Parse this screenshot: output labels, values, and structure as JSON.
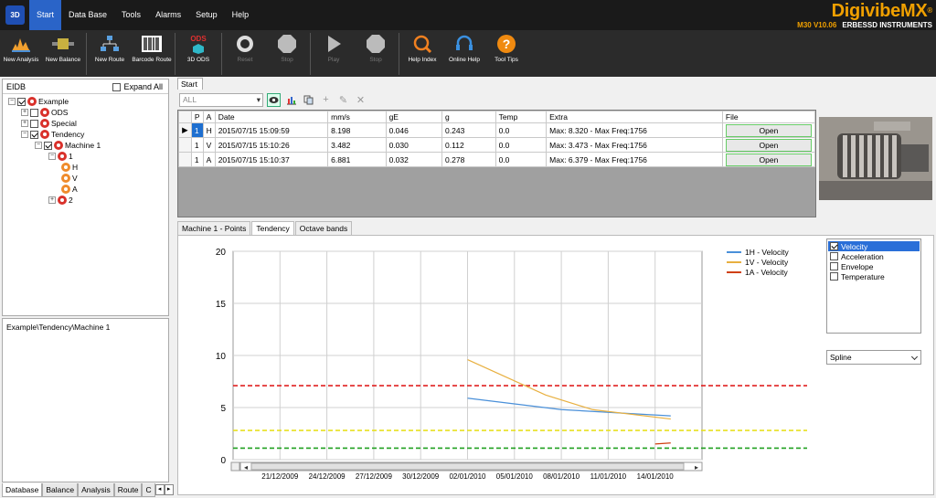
{
  "menu": {
    "logo": "3D",
    "items": [
      "Start",
      "Data Base",
      "Tools",
      "Alarms",
      "Setup",
      "Help"
    ],
    "active": "Start"
  },
  "brand": {
    "name": "DigivibeMX",
    "trademark": "®",
    "version": "M30 V10.06",
    "company": "ERBESSD INSTRUMENTS"
  },
  "ribbon": {
    "buttons": [
      {
        "label": "New Analysis",
        "icon": "spectrum-icon"
      },
      {
        "label": "New Balance",
        "icon": "rotor-icon"
      },
      {
        "label": "New Route",
        "icon": "org-chart-icon"
      },
      {
        "label": "Barcode Route",
        "icon": "barcode-icon"
      },
      {
        "label": "3D ODS",
        "icon": "ods-cube-icon",
        "badge": "ODS"
      },
      {
        "label": "Reset",
        "icon": "reset-icon"
      },
      {
        "label": "Stop",
        "icon": "stop-icon"
      },
      {
        "label": "Play",
        "icon": "play-icon"
      },
      {
        "label": "Stop",
        "icon": "stop-icon"
      },
      {
        "label": "Help Index",
        "icon": "help-index-icon"
      },
      {
        "label": "Online Help",
        "icon": "headset-icon"
      },
      {
        "label": "Tool Tips",
        "icon": "question-icon"
      }
    ]
  },
  "eidb": {
    "title": "EIDB",
    "expand_all": "Expand All",
    "tree": [
      {
        "label": "Example"
      },
      {
        "label": "ODS"
      },
      {
        "label": "Special"
      },
      {
        "label": "Tendency"
      },
      {
        "label": "Machine 1"
      },
      {
        "label": "1"
      },
      {
        "label": "H"
      },
      {
        "label": "V"
      },
      {
        "label": "A"
      },
      {
        "label": "2"
      }
    ]
  },
  "path_panel": {
    "path": "Example\\Tendency\\Machine 1"
  },
  "bottom_tabs": [
    "Database",
    "Balance",
    "Analysis",
    "Route",
    "C"
  ],
  "main_tab": "Start",
  "filter_combo": "ALL",
  "grid": {
    "columns": [
      "P",
      "A",
      "Date",
      "mm/s",
      "gE",
      "g",
      "Temp",
      "Extra",
      "File"
    ],
    "rows": [
      {
        "p": "1",
        "a": "H",
        "date": "2015/07/15 15:09:59",
        "mms": "8.198",
        "ge": "0.046",
        "g": "0.243",
        "temp": "0.0",
        "extra": "Max: 8.320 - Max Freq:1756",
        "file": "Open"
      },
      {
        "p": "1",
        "a": "V",
        "date": "2015/07/15 15:10:26",
        "mms": "3.482",
        "ge": "0.030",
        "g": "0.112",
        "temp": "0.0",
        "extra": "Max: 3.473 - Max Freq:1756",
        "file": "Open"
      },
      {
        "p": "1",
        "a": "A",
        "date": "2015/07/15 15:10:37",
        "mms": "6.881",
        "ge": "0.032",
        "g": "0.278",
        "temp": "0.0",
        "extra": "Max: 6.379 - Max Freq:1756",
        "file": "Open"
      }
    ]
  },
  "chart_tabs": [
    "Machine 1 - Points",
    "Tendency",
    "Octave bands"
  ],
  "chart_tab_active": "Tendency",
  "series_options": [
    {
      "label": "Velocity",
      "checked": true
    },
    {
      "label": "Acceleration",
      "checked": false
    },
    {
      "label": "Envelope",
      "checked": false
    },
    {
      "label": "Temperature",
      "checked": false
    }
  ],
  "interp_select": "Spline",
  "chart_data": {
    "type": "line",
    "x_ticks": [
      "21/12/2009",
      "24/12/2009",
      "27/12/2009",
      "30/12/2009",
      "02/01/2010",
      "05/01/2010",
      "08/01/2010",
      "11/01/2010",
      "14/01/2010"
    ],
    "xlim": [
      "2009-12-18",
      "2010-01-17"
    ],
    "ylim": [
      0,
      20
    ],
    "y_ticks": [
      0,
      5,
      10,
      15,
      20
    ],
    "grid": true,
    "legend_position": "top-right",
    "series": [
      {
        "name": "1H - Velocity",
        "color": "#4a90d9",
        "points": [
          [
            "2010-01-02",
            5.9
          ],
          [
            "2010-01-08",
            4.8
          ],
          [
            "2010-01-15",
            4.2
          ]
        ]
      },
      {
        "name": "1V - Velocity",
        "color": "#e8b040",
        "points": [
          [
            "2010-01-02",
            9.6
          ],
          [
            "2010-01-07",
            6.2
          ],
          [
            "2010-01-10",
            4.8
          ],
          [
            "2010-01-15",
            3.9
          ]
        ]
      },
      {
        "name": "1A - Velocity",
        "color": "#d04010",
        "points": [
          [
            "2010-01-14",
            1.5
          ],
          [
            "2010-01-15",
            1.6
          ]
        ]
      }
    ],
    "thresholds": [
      {
        "value": 7.1,
        "color": "#e02020"
      },
      {
        "value": 2.8,
        "color": "#e8e020"
      },
      {
        "value": 1.1,
        "color": "#20a020"
      }
    ]
  }
}
